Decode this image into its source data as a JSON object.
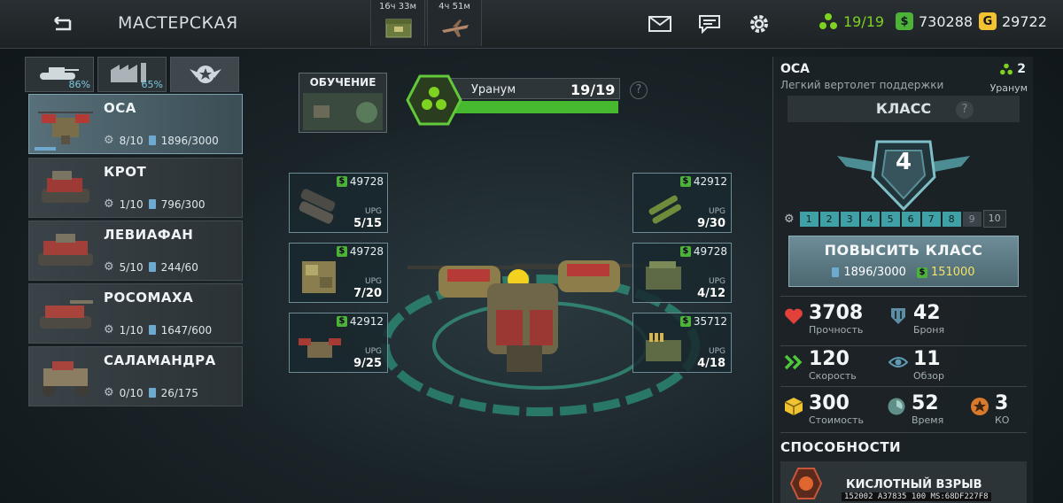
{
  "header": {
    "title": "МАСТЕРСКАЯ",
    "timers": [
      {
        "label": "16ч 33м",
        "icon": "crate-icon"
      },
      {
        "label": "4ч 51м",
        "icon": "plane-icon"
      }
    ],
    "resources": {
      "uranium": "19/19",
      "money": "730288",
      "gold": "29722"
    },
    "colors": {
      "uranium": "#7ed321",
      "money": "#4cb338",
      "gold": "#f2c230"
    }
  },
  "tabs": [
    {
      "name": "tank-tab",
      "percent": "86%"
    },
    {
      "name": "factory-tab",
      "percent": "65%"
    },
    {
      "name": "emblem-tab",
      "percent": ""
    }
  ],
  "units": [
    {
      "name": "ОСА",
      "parts": "8/10",
      "cards": "1896/3000",
      "selected": true
    },
    {
      "name": "КРОТ",
      "parts": "1/10",
      "cards": "796/300"
    },
    {
      "name": "ЛЕВИАФАН",
      "parts": "5/10",
      "cards": "244/60"
    },
    {
      "name": "РОСОМАХА",
      "parts": "1/10",
      "cards": "1647/600"
    },
    {
      "name": "САЛАМАНДРА",
      "parts": "0/10",
      "cards": "26/175"
    }
  ],
  "training": {
    "label": "ОБУЧЕНИЕ"
  },
  "uranium": {
    "label": "Уранум",
    "count": "19/19",
    "help": "?",
    "fill": 1.0
  },
  "slots_left": [
    {
      "cost": "49728",
      "upg": "UPG",
      "count": "5/15"
    },
    {
      "cost": "49728",
      "upg": "UPG",
      "count": "7/20"
    },
    {
      "cost": "42912",
      "upg": "UPG",
      "count": "9/25"
    }
  ],
  "slots_right": [
    {
      "cost": "42912",
      "upg": "UPG",
      "count": "9/30"
    },
    {
      "cost": "49728",
      "upg": "UPG",
      "count": "4/12"
    },
    {
      "cost": "35712",
      "upg": "UPG",
      "count": "4/18"
    }
  ],
  "detail": {
    "name": "ОСА",
    "subtitle": "Легкий вертолет поддержки",
    "uranium_cost": "2",
    "uranium_label": "Уранум",
    "class_label": "КЛАСС",
    "class_help": "?",
    "class_value": "4",
    "levels": [
      "1",
      "2",
      "3",
      "4",
      "5",
      "6",
      "7",
      "8",
      "9",
      "10"
    ],
    "upgrade": {
      "label": "ПОВЫСИТЬ КЛАСС",
      "cards": "1896/3000",
      "money": "151000"
    },
    "stats": {
      "hp": {
        "value": "3708",
        "label": "Прочность"
      },
      "armor": {
        "value": "42",
        "label": "Броня"
      },
      "speed": {
        "value": "120",
        "label": "Скорость"
      },
      "vision": {
        "value": "11",
        "label": "Обзор"
      },
      "cost": {
        "value": "300",
        "label": "Стоимость"
      },
      "time": {
        "value": "52",
        "label": "Время"
      },
      "ko": {
        "value": "3",
        "label": "КО"
      }
    },
    "abilities_title": "СПОСОБНОСТИ",
    "ability": {
      "name": "КИСЛОТНЫЙ ВЗРЫВ"
    }
  },
  "debug": "152002 A37835 100 MS:68DF227F8"
}
